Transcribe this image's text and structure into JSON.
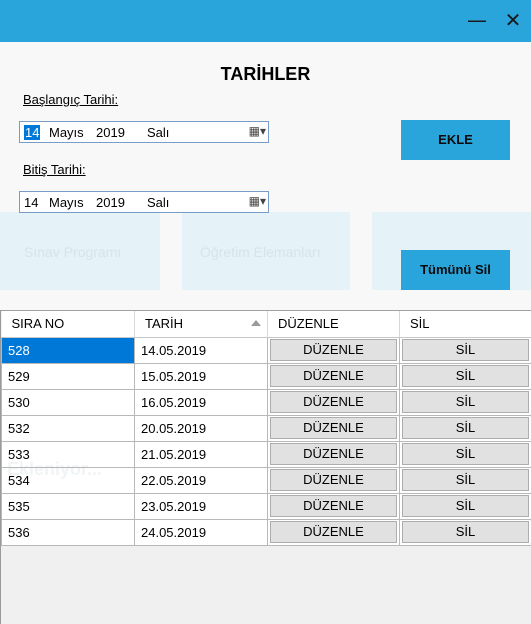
{
  "window": {
    "minimize_glyph": "—",
    "close_glyph": "✕"
  },
  "form": {
    "title": "TARİHLER",
    "start_label": "Başlangıç Tarihi:",
    "start_date": {
      "day": "14",
      "month": "Mayıs",
      "year": "2019",
      "weekday": "Salı"
    },
    "end_label": "Bitiş Tarihi:",
    "end_date": {
      "day": "14",
      "month": "Mayıs",
      "year": "2019",
      "weekday": "Salı"
    },
    "add_button": "EKLE",
    "delete_all_button": "Tümünü Sil"
  },
  "background_ghost": {
    "text1": "Sınav Programı",
    "text2": "Öğretim Elemanları",
    "text3": "Ekleniyor..."
  },
  "grid": {
    "columns": [
      "SIRA NO",
      "TARİH",
      "DÜZENLE",
      "SİL"
    ],
    "rows": [
      {
        "no": "528",
        "date": "14.05.2019",
        "edit": "DÜZENLE",
        "del": "SİL"
      },
      {
        "no": "529",
        "date": "15.05.2019",
        "edit": "DÜZENLE",
        "del": "SİL"
      },
      {
        "no": "530",
        "date": "16.05.2019",
        "edit": "DÜZENLE",
        "del": "SİL"
      },
      {
        "no": "532",
        "date": "20.05.2019",
        "edit": "DÜZENLE",
        "del": "SİL"
      },
      {
        "no": "533",
        "date": "21.05.2019",
        "edit": "DÜZENLE",
        "del": "SİL"
      },
      {
        "no": "534",
        "date": "22.05.2019",
        "edit": "DÜZENLE",
        "del": "SİL"
      },
      {
        "no": "535",
        "date": "23.05.2019",
        "edit": "DÜZENLE",
        "del": "SİL"
      },
      {
        "no": "536",
        "date": "24.05.2019",
        "edit": "DÜZENLE",
        "del": "SİL"
      }
    ]
  },
  "colors": {
    "accent": "#2aa5dc",
    "selection": "#0078d7"
  }
}
